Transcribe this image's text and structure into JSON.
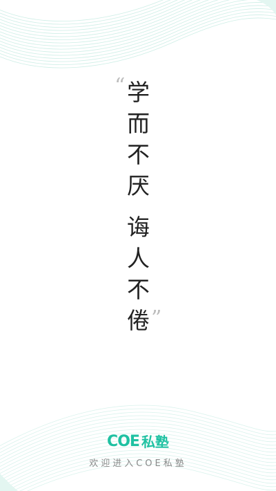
{
  "slogan": {
    "open_quote": "“",
    "close_quote": "”",
    "line1": [
      "学",
      "而",
      "不",
      "厌"
    ],
    "line2": [
      "诲",
      "人",
      "不",
      "倦"
    ]
  },
  "logo": {
    "brand": "COE",
    "name": "私塾"
  },
  "tagline": "欢迎进入COE私塾",
  "colors": {
    "accent": "#1fc1a2",
    "text": "#222222",
    "tagline": "#8a8a8a",
    "quote": "#bdbdbd",
    "decoration": "#cdeee6"
  }
}
